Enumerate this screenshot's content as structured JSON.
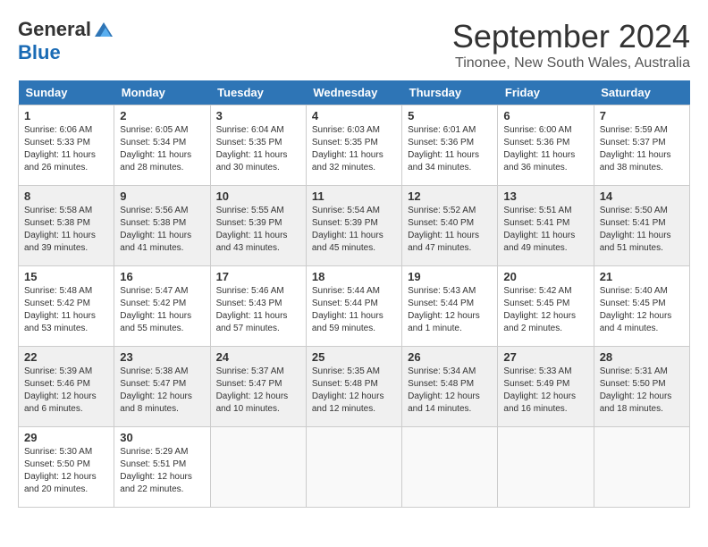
{
  "header": {
    "logo_general": "General",
    "logo_blue": "Blue",
    "month_title": "September 2024",
    "location": "Tinonee, New South Wales, Australia"
  },
  "calendar": {
    "days_of_week": [
      "Sunday",
      "Monday",
      "Tuesday",
      "Wednesday",
      "Thursday",
      "Friday",
      "Saturday"
    ],
    "weeks": [
      [
        {
          "day": "",
          "info": ""
        },
        {
          "day": "2",
          "info": "Sunrise: 6:05 AM\nSunset: 5:34 PM\nDaylight: 11 hours\nand 28 minutes."
        },
        {
          "day": "3",
          "info": "Sunrise: 6:04 AM\nSunset: 5:35 PM\nDaylight: 11 hours\nand 30 minutes."
        },
        {
          "day": "4",
          "info": "Sunrise: 6:03 AM\nSunset: 5:35 PM\nDaylight: 11 hours\nand 32 minutes."
        },
        {
          "day": "5",
          "info": "Sunrise: 6:01 AM\nSunset: 5:36 PM\nDaylight: 11 hours\nand 34 minutes."
        },
        {
          "day": "6",
          "info": "Sunrise: 6:00 AM\nSunset: 5:36 PM\nDaylight: 11 hours\nand 36 minutes."
        },
        {
          "day": "7",
          "info": "Sunrise: 5:59 AM\nSunset: 5:37 PM\nDaylight: 11 hours\nand 38 minutes."
        }
      ],
      [
        {
          "day": "1",
          "info": "Sunrise: 6:06 AM\nSunset: 5:33 PM\nDaylight: 11 hours\nand 26 minutes."
        },
        {
          "day": "9",
          "info": "Sunrise: 5:56 AM\nSunset: 5:38 PM\nDaylight: 11 hours\nand 41 minutes."
        },
        {
          "day": "10",
          "info": "Sunrise: 5:55 AM\nSunset: 5:39 PM\nDaylight: 11 hours\nand 43 minutes."
        },
        {
          "day": "11",
          "info": "Sunrise: 5:54 AM\nSunset: 5:39 PM\nDaylight: 11 hours\nand 45 minutes."
        },
        {
          "day": "12",
          "info": "Sunrise: 5:52 AM\nSunset: 5:40 PM\nDaylight: 11 hours\nand 47 minutes."
        },
        {
          "day": "13",
          "info": "Sunrise: 5:51 AM\nSunset: 5:41 PM\nDaylight: 11 hours\nand 49 minutes."
        },
        {
          "day": "14",
          "info": "Sunrise: 5:50 AM\nSunset: 5:41 PM\nDaylight: 11 hours\nand 51 minutes."
        }
      ],
      [
        {
          "day": "8",
          "info": "Sunrise: 5:58 AM\nSunset: 5:38 PM\nDaylight: 11 hours\nand 39 minutes."
        },
        {
          "day": "16",
          "info": "Sunrise: 5:47 AM\nSunset: 5:42 PM\nDaylight: 11 hours\nand 55 minutes."
        },
        {
          "day": "17",
          "info": "Sunrise: 5:46 AM\nSunset: 5:43 PM\nDaylight: 11 hours\nand 57 minutes."
        },
        {
          "day": "18",
          "info": "Sunrise: 5:44 AM\nSunset: 5:44 PM\nDaylight: 11 hours\nand 59 minutes."
        },
        {
          "day": "19",
          "info": "Sunrise: 5:43 AM\nSunset: 5:44 PM\nDaylight: 12 hours\nand 1 minute."
        },
        {
          "day": "20",
          "info": "Sunrise: 5:42 AM\nSunset: 5:45 PM\nDaylight: 12 hours\nand 2 minutes."
        },
        {
          "day": "21",
          "info": "Sunrise: 5:40 AM\nSunset: 5:45 PM\nDaylight: 12 hours\nand 4 minutes."
        }
      ],
      [
        {
          "day": "15",
          "info": "Sunrise: 5:48 AM\nSunset: 5:42 PM\nDaylight: 11 hours\nand 53 minutes."
        },
        {
          "day": "23",
          "info": "Sunrise: 5:38 AM\nSunset: 5:47 PM\nDaylight: 12 hours\nand 8 minutes."
        },
        {
          "day": "24",
          "info": "Sunrise: 5:37 AM\nSunset: 5:47 PM\nDaylight: 12 hours\nand 10 minutes."
        },
        {
          "day": "25",
          "info": "Sunrise: 5:35 AM\nSunset: 5:48 PM\nDaylight: 12 hours\nand 12 minutes."
        },
        {
          "day": "26",
          "info": "Sunrise: 5:34 AM\nSunset: 5:48 PM\nDaylight: 12 hours\nand 14 minutes."
        },
        {
          "day": "27",
          "info": "Sunrise: 5:33 AM\nSunset: 5:49 PM\nDaylight: 12 hours\nand 16 minutes."
        },
        {
          "day": "28",
          "info": "Sunrise: 5:31 AM\nSunset: 5:50 PM\nDaylight: 12 hours\nand 18 minutes."
        }
      ],
      [
        {
          "day": "22",
          "info": "Sunrise: 5:39 AM\nSunset: 5:46 PM\nDaylight: 12 hours\nand 6 minutes."
        },
        {
          "day": "30",
          "info": "Sunrise: 5:29 AM\nSunset: 5:51 PM\nDaylight: 12 hours\nand 22 minutes."
        },
        {
          "day": "",
          "info": ""
        },
        {
          "day": "",
          "info": ""
        },
        {
          "day": "",
          "info": ""
        },
        {
          "day": "",
          "info": ""
        },
        {
          "day": "",
          "info": ""
        }
      ],
      [
        {
          "day": "29",
          "info": "Sunrise: 5:30 AM\nSunset: 5:50 PM\nDaylight: 12 hours\nand 20 minutes."
        },
        {
          "day": "",
          "info": ""
        },
        {
          "day": "",
          "info": ""
        },
        {
          "day": "",
          "info": ""
        },
        {
          "day": "",
          "info": ""
        },
        {
          "day": "",
          "info": ""
        },
        {
          "day": "",
          "info": ""
        }
      ]
    ]
  }
}
